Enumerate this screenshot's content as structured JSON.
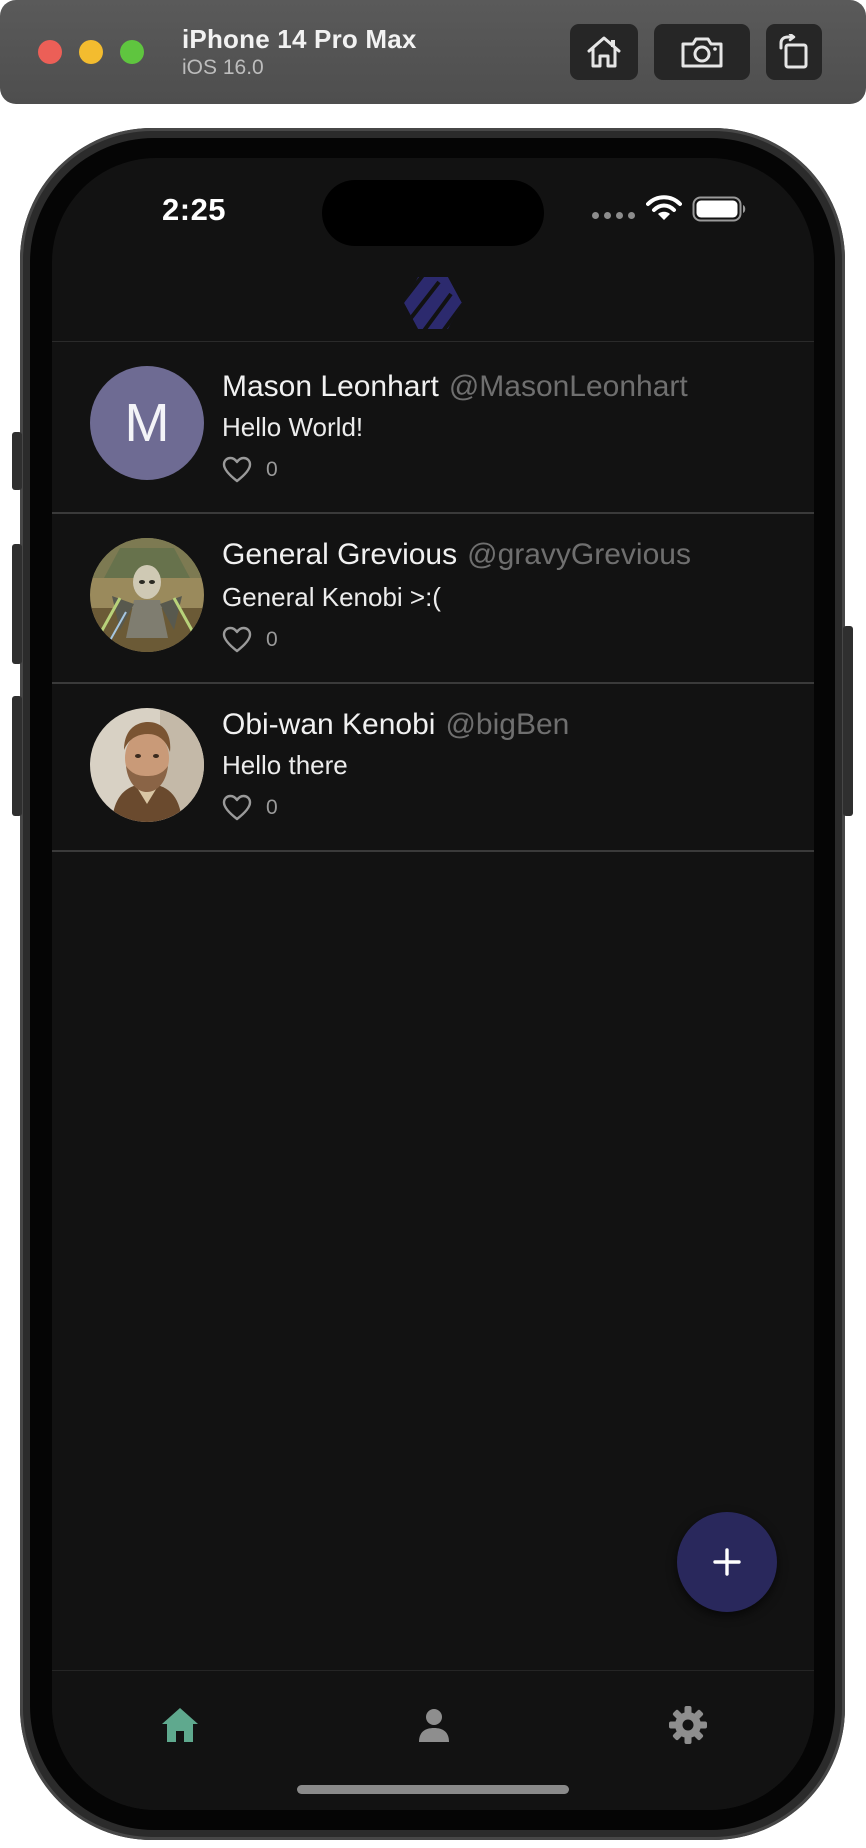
{
  "simulator": {
    "device_name": "iPhone 14 Pro Max",
    "os_version": "iOS 16.0"
  },
  "status_bar": {
    "time": "2:25"
  },
  "feed": {
    "posts": [
      {
        "display_name": "Mason Leonhart",
        "handle": "@MasonLeonhart",
        "text": "Hello World!",
        "likes": "0",
        "avatar_letter": "M"
      },
      {
        "display_name": "General Grevious",
        "handle": "@gravyGrevious",
        "text": "General Kenobi >:(",
        "likes": "0"
      },
      {
        "display_name": "Obi-wan Kenobi",
        "handle": "@bigBen",
        "text": "Hello there",
        "likes": "0"
      }
    ]
  },
  "colors": {
    "background": "#121212",
    "fab": "#29285c",
    "active_tab": "#5fa98e",
    "inactive_tab": "#8e8e8e",
    "logo": "#2c2a6e"
  },
  "icons": {
    "logo": "hexagon-logo-icon",
    "like": "heart-outline-icon",
    "fab": "plus-icon",
    "tabs": [
      "home-icon",
      "person-icon",
      "gear-icon"
    ]
  }
}
